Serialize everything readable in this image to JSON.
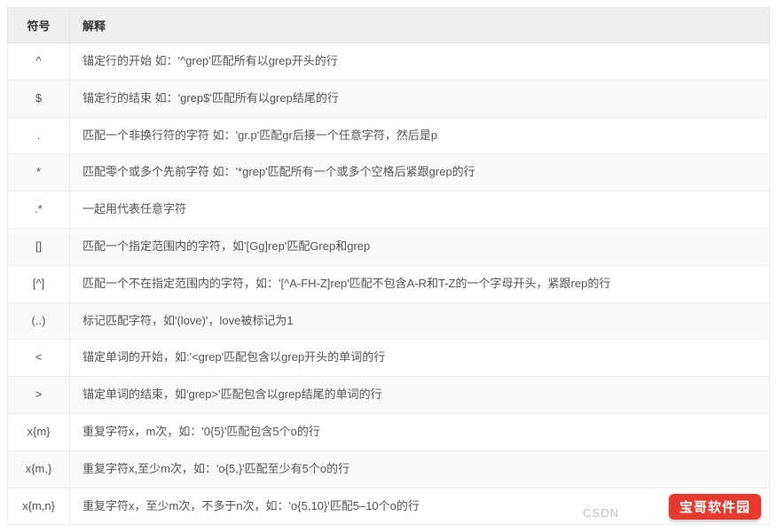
{
  "table": {
    "headers": {
      "symbol": "符号",
      "explanation": "解释"
    },
    "rows": [
      {
        "symbol": "^",
        "explanation": "锚定行的开始 如：'^grep'匹配所有以grep开头的行"
      },
      {
        "symbol": "$",
        "explanation": "锚定行的结束 如：'grep$'匹配所有以grep结尾的行"
      },
      {
        "symbol": ".",
        "explanation": "匹配一个非换行符的字符 如：'gr.p'匹配gr后接一个任意字符，然后是p"
      },
      {
        "symbol": "*",
        "explanation": "匹配零个或多个先前字符 如：'*grep'匹配所有一个或多个空格后紧跟grep的行"
      },
      {
        "symbol": ".*",
        "explanation": "一起用代表任意字符"
      },
      {
        "symbol": "[]",
        "explanation": "匹配一个指定范围内的字符，如'[Gg]rep'匹配Grep和grep"
      },
      {
        "symbol": "[^]",
        "explanation": "匹配一个不在指定范围内的字符，如：'[^A-FH-Z]rep'匹配不包含A-R和T-Z的一个字母开头，紧跟rep的行"
      },
      {
        "symbol": "(..)",
        "explanation": "标记匹配字符，如'(love)'，love被标记为1"
      },
      {
        "symbol": "<",
        "explanation": "锚定单词的开始，如:'<grep'匹配包含以grep开头的单词的行"
      },
      {
        "symbol": ">",
        "explanation": "锚定单词的结束，如'grep>'匹配包含以grep结尾的单词的行"
      },
      {
        "symbol": "x{m}",
        "explanation": "重复字符x，m次，如：'0{5}'匹配包含5个o的行"
      },
      {
        "symbol": "x{m,}",
        "explanation": "重复字符x,至少m次，如：'o{5,}'匹配至少有5个o的行"
      },
      {
        "symbol": "x{m,n}",
        "explanation": "重复字符x，至少m次，不多于n次，如：'o{5,10}'匹配5–10个o的行"
      }
    ]
  },
  "watermark": {
    "csdn": "CSDN",
    "badge": "宝哥软件园"
  }
}
